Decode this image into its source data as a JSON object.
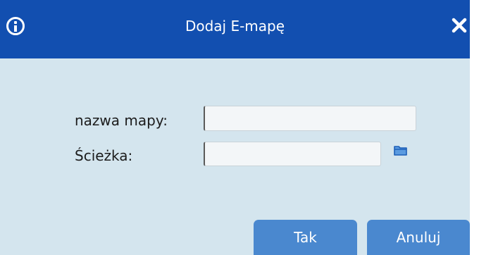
{
  "dialog": {
    "title": "Dodaj E-mapę",
    "info_icon": "info-icon",
    "close_icon": "close-icon"
  },
  "form": {
    "name_label": "nazwa mapy:",
    "name_value": "",
    "path_label": "Ścieżka:",
    "path_value": "",
    "browse_icon": "folder-icon"
  },
  "buttons": {
    "ok_label": "Tak",
    "cancel_label": "Anuluj"
  },
  "colors": {
    "titlebar": "#124fb0",
    "background": "#d4e5ee",
    "button": "#4a88cf"
  }
}
